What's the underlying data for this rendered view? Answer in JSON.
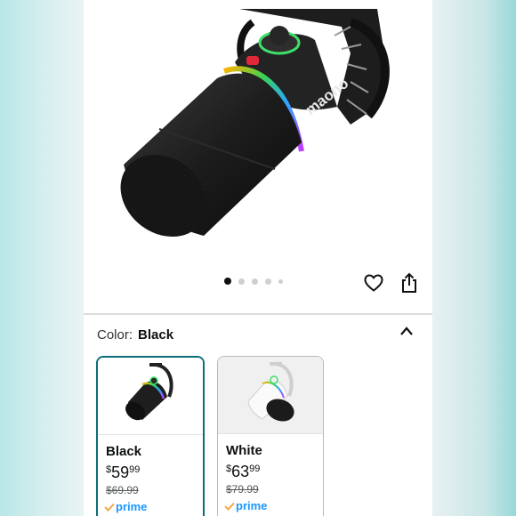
{
  "carousel": {
    "total_images": 5,
    "active_index": 0
  },
  "product": {
    "brand_text": "maono"
  },
  "color_selector": {
    "label": "Color:",
    "selected": "Black",
    "options": [
      {
        "name": "Black",
        "currency": "$",
        "price_whole": "59",
        "price_cents": "99",
        "list_price": "$69.99",
        "prime_label": "prime"
      },
      {
        "name": "White",
        "currency": "$",
        "price_whole": "63",
        "price_cents": "99",
        "list_price": "$79.99",
        "prime_label": "prime"
      }
    ]
  },
  "icons": {
    "wishlist": "heart-icon",
    "share": "share-icon",
    "collapse": "chevron-up-icon",
    "prime": "prime-check-icon"
  },
  "colors": {
    "accent": "#0b6e7a",
    "prime": "#1a98ff",
    "strike": "#565959"
  }
}
